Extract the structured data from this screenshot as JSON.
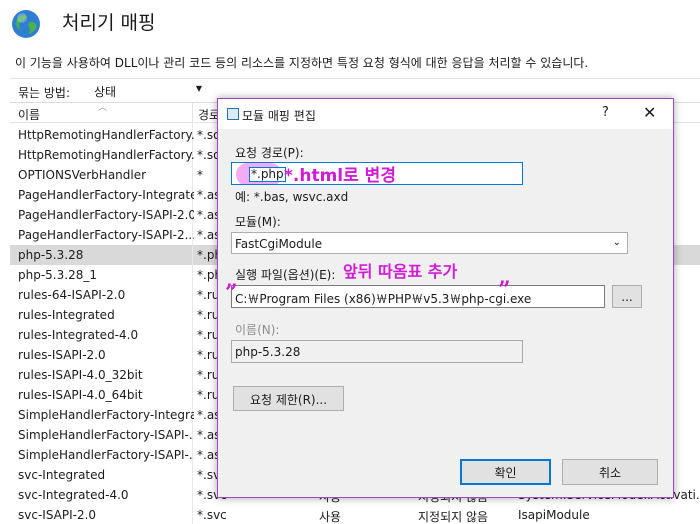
{
  "header": {
    "title": "처리기 매핑",
    "description": "이 기능을 사용하여 DLL이나 관리 코드 등의 리소스를 지정하면 특정 요청 형식에 대한 응답을 처리할 수 있습니다."
  },
  "group_by": {
    "label": "묶는 방법:",
    "value": "상태"
  },
  "table": {
    "columns": [
      "이름",
      "경로",
      "",
      "",
      ""
    ],
    "rows": [
      [
        "HttpRemotingHandlerFactory...",
        "*.so",
        "",
        "",
        ""
      ],
      [
        "HttpRemotingHandlerFactory...",
        "*.so",
        "",
        "",
        ""
      ],
      [
        "HttpRemotingHandlerFactory...",
        "*.so",
        "",
        "",
        ""
      ],
      [
        "OPTIONSVerbHandler",
        "*",
        "",
        "",
        ""
      ],
      [
        "PageHandlerFactory-Integrated",
        "*.as",
        "",
        "",
        ""
      ],
      [
        "PageHandlerFactory-ISAPI-2.0",
        "*.as",
        "",
        "",
        ""
      ],
      [
        "PageHandlerFactory-ISAPI-2....",
        "*.as",
        "",
        "",
        ""
      ],
      [
        "php-5.3.28",
        "*.ph",
        "",
        "",
        ""
      ],
      [
        "php-5.3.28_1",
        "*.ph",
        "",
        "",
        ""
      ],
      [
        "rules-64-ISAPI-2.0",
        "*.ru",
        "",
        "",
        ""
      ],
      [
        "rules-Integrated",
        "*.ru",
        "",
        "",
        ""
      ],
      [
        "rules-Integrated-4.0",
        "*.ru",
        "",
        "",
        ""
      ],
      [
        "rules-ISAPI-2.0",
        "*.ru",
        "",
        "",
        ""
      ],
      [
        "rules-ISAPI-4.0_32bit",
        "*.ru",
        "",
        "",
        ""
      ],
      [
        "rules-ISAPI-4.0_64bit",
        "*.ru",
        "",
        "",
        ""
      ],
      [
        "SimpleHandlerFactory-Integra...",
        "*.as",
        "",
        "",
        ""
      ],
      [
        "SimpleHandlerFactory-ISAPI-...",
        "*.as",
        "",
        "",
        ""
      ],
      [
        "SimpleHandlerFactory-ISAPI-...",
        "*.as",
        "",
        "",
        ""
      ],
      [
        "svc-Integrated",
        "*.svc",
        "",
        "",
        ""
      ],
      [
        "svc-Integrated-4.0",
        "*.svc",
        "사용",
        "지정되지 않음",
        "System.ServiceModel.Activati..."
      ],
      [
        "svc-ISAPI-2.0",
        "*.svc",
        "사용",
        "지정되지 않음",
        "IsapiModule"
      ]
    ],
    "selected_row": 7
  },
  "dialog": {
    "title": "모듈 매핑 편집",
    "help": "?",
    "close": "✕",
    "request_path": {
      "label": "요청 경로(P):",
      "value": "*.php",
      "example": "예: *.bas, wsvc.axd"
    },
    "module": {
      "label": "모듈(M):",
      "value": "FastCgiModule"
    },
    "executable": {
      "label": "실행 파일(옵션)(E):",
      "value": "C:￦Program Files (x86)￦PHP￦v5.3￦php-cgi.exe",
      "browse_label": "..."
    },
    "name": {
      "label": "이름(N):",
      "value": "php-5.3.28"
    },
    "restrictions_button": "요청 제한(R)...",
    "ok_button": "확인",
    "cancel_button": "취소"
  },
  "annotations": {
    "path_note": "*.html로 변경",
    "exe_note": "앞뒤 따옴표 추가",
    "open_quote": "”",
    "close_quote": "”"
  },
  "colors": {
    "annotation": "#d21bd8",
    "accent": "#0078d7",
    "dialog_border": "#9b49c9"
  }
}
